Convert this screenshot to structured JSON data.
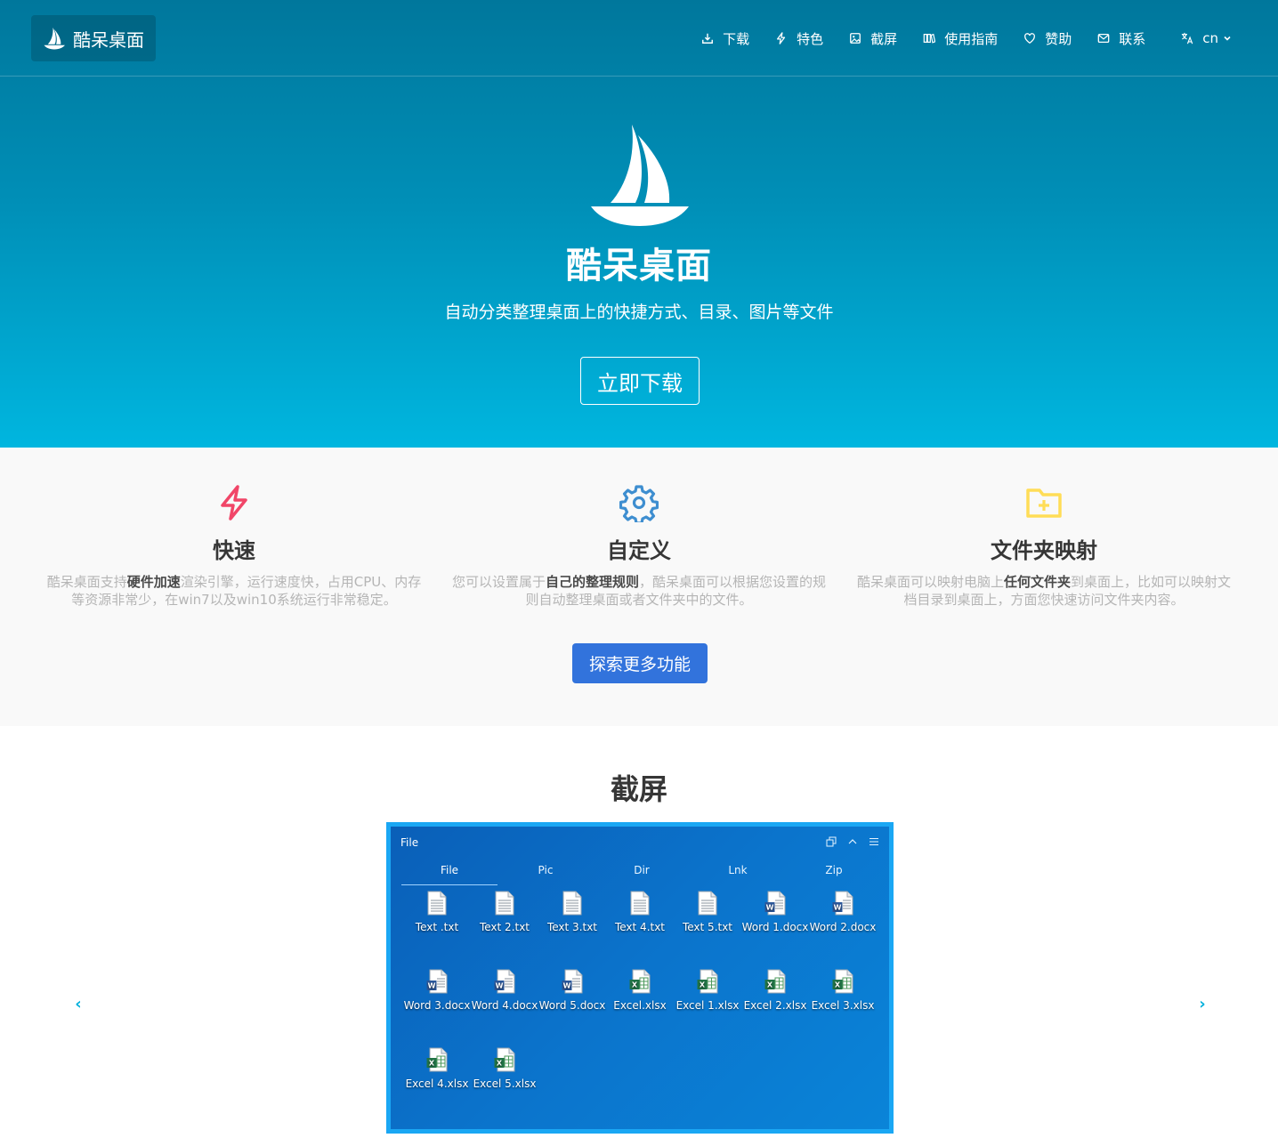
{
  "brand": {
    "name": "酷呆桌面"
  },
  "nav": {
    "items": [
      {
        "label": "下载",
        "icon": "download-icon"
      },
      {
        "label": "特色",
        "icon": "bolt-icon"
      },
      {
        "label": "截屏",
        "icon": "image-icon"
      },
      {
        "label": "使用指南",
        "icon": "book-icon"
      },
      {
        "label": "赞助",
        "icon": "heart-icon"
      },
      {
        "label": "联系",
        "icon": "mail-icon"
      }
    ],
    "language": {
      "label": "cn",
      "icon": "translate-icon"
    }
  },
  "hero": {
    "title": "酷呆桌面",
    "subtitle": "自动分类整理桌面上的快捷方式、目录、图片等文件",
    "cta": "立即下载"
  },
  "features": {
    "items": [
      {
        "title": "快速",
        "icon": "bolt-icon",
        "color": "#f14668",
        "desc_pre": "酷呆桌面支持",
        "desc_bold": "硬件加速",
        "desc_post": "渲染引擎，运行速度快，占用CPU、内存等资源非常少，在win7以及win10系统运行非常稳定。"
      },
      {
        "title": "自定义",
        "icon": "gear-icon",
        "color": "#3e8ed0",
        "desc_pre": "您可以设置属于",
        "desc_bold": "自己的整理规则",
        "desc_post": "，酷呆桌面可以根据您设置的规则自动整理桌面或者文件夹中的文件。"
      },
      {
        "title": "文件夹映射",
        "icon": "folder-plus-icon",
        "color": "#ffdd57",
        "desc_pre": "酷呆桌面可以映射电脑上",
        "desc_bold": "任何文件夹",
        "desc_post": "到桌面上，比如可以映射文档目录到桌面上，方面您快速访问文件夹内容。"
      }
    ],
    "explore": "探索更多功能"
  },
  "screenshots": {
    "title": "截屏",
    "prev": "‹",
    "next": "›",
    "window": {
      "title": "File",
      "tabs": [
        "File",
        "Pic",
        "Dir",
        "Lnk",
        "Zip"
      ],
      "files": [
        {
          "name": "Text .txt",
          "type": "txt"
        },
        {
          "name": "Text 2.txt",
          "type": "txt"
        },
        {
          "name": "Text 3.txt",
          "type": "txt"
        },
        {
          "name": "Text 4.txt",
          "type": "txt"
        },
        {
          "name": "Text 5.txt",
          "type": "txt"
        },
        {
          "name": "Word 1.docx",
          "type": "word"
        },
        {
          "name": "Word 2.docx",
          "type": "word"
        },
        {
          "name": "Word 3.docx",
          "type": "word"
        },
        {
          "name": "Word 4.docx",
          "type": "word"
        },
        {
          "name": "Word 5.docx",
          "type": "word"
        },
        {
          "name": "Excel.xlsx",
          "type": "excel"
        },
        {
          "name": "Excel 1.xlsx",
          "type": "excel"
        },
        {
          "name": "Excel 2.xlsx",
          "type": "excel"
        },
        {
          "name": "Excel 3.xlsx",
          "type": "excel"
        },
        {
          "name": "Excel 4.xlsx",
          "type": "excel"
        },
        {
          "name": "Excel 5.xlsx",
          "type": "excel"
        }
      ]
    }
  }
}
